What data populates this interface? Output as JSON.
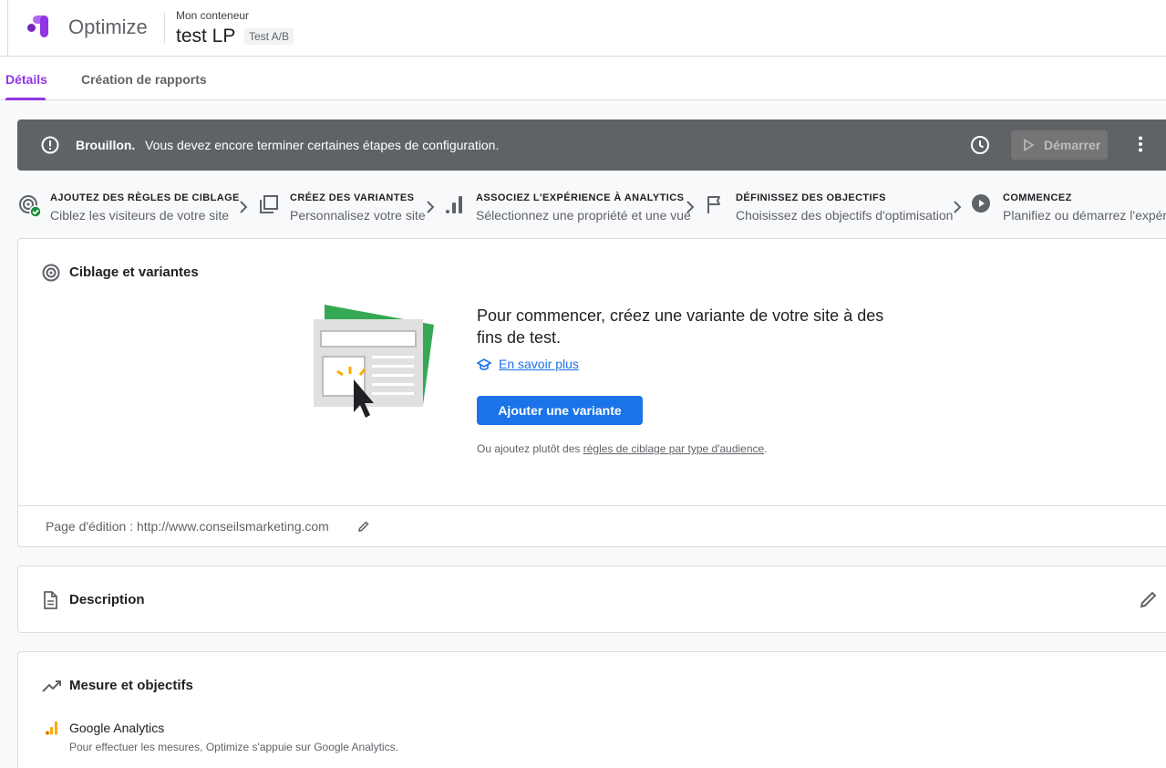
{
  "header": {
    "brand": "Optimize",
    "container_label": "Mon conteneur",
    "experience_name": "test LP",
    "experience_type": "Test A/B"
  },
  "tabs": [
    {
      "label": "Détails",
      "active": true
    },
    {
      "label": "Création de rapports",
      "active": false
    }
  ],
  "banner": {
    "title": "Brouillon.",
    "message": "Vous devez encore terminer certaines étapes de configuration.",
    "start_label": "Démarrer"
  },
  "steps": [
    {
      "title": "AJOUTEZ DES RÈGLES DE CIBLAGE",
      "subtitle": "Ciblez les visiteurs de votre site",
      "completed": true
    },
    {
      "title": "CRÉEZ DES VARIANTES",
      "subtitle": "Personnalisez votre site",
      "completed": false
    },
    {
      "title": "ASSOCIEZ L'EXPÉRIENCE À ANALYTICS",
      "subtitle": "Sélectionnez une propriété et une vue",
      "completed": false
    },
    {
      "title": "DÉFINISSEZ DES OBJECTIFS",
      "subtitle": "Choisissez des objectifs d'optimisation",
      "completed": false
    },
    {
      "title": "COMMENCEZ",
      "subtitle": "Planifiez ou démarrez l'expérience",
      "completed": false
    }
  ],
  "targeting_card": {
    "title": "Ciblage et variantes",
    "heading": "Pour commencer, créez une variante de votre site à des fins de test.",
    "learn_more": "En savoir plus",
    "add_variant": "Ajouter une variante",
    "alt_prefix": "Ou ajoutez plutôt des ",
    "alt_link": "règles de ciblage par type d'audience",
    "alt_suffix": ".",
    "edit_page": "Page d'édition : http://www.conseilsmarketing.com"
  },
  "description_card": {
    "title": "Description"
  },
  "measure_card": {
    "title": "Mesure et objectifs",
    "ga_title": "Google Analytics",
    "ga_desc": "Pour effectuer les mesures, Optimize s'appuie sur Google Analytics."
  },
  "colors": {
    "accent": "#9334e6",
    "primary": "#1a73e8",
    "banner": "#5f6368",
    "success": "#1e8e3e"
  }
}
